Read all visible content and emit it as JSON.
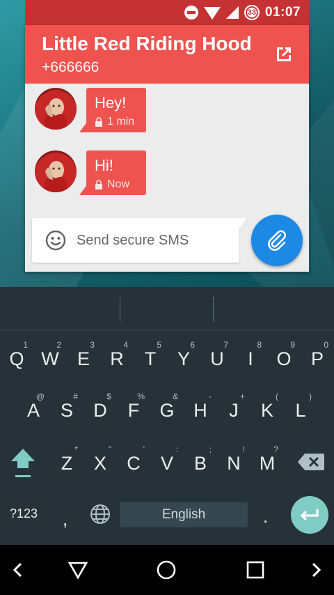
{
  "status_bar": {
    "notification_count": "33",
    "time": "01:07",
    "icons": [
      "do-not-disturb-icon",
      "wifi-icon",
      "cell-signal-icon",
      "notification-badge-icon"
    ]
  },
  "conversation": {
    "contact_name": "Little Red Riding Hood",
    "phone_number": "+666666",
    "open_icon": "open-in-new-icon",
    "messages": [
      {
        "text": "Hey!",
        "time": "1 min",
        "secure": true
      },
      {
        "text": "Hi!",
        "time": "Now",
        "secure": true
      }
    ]
  },
  "composer": {
    "placeholder": "Send secure SMS",
    "emoji_icon": "emoji-icon",
    "attach_icon": "paperclip-icon"
  },
  "colors": {
    "header": "#ef5350",
    "status_bar": "#c53234",
    "attach_button": "#1e88e5",
    "keyboard": "#263238",
    "enter_key": "#80cbc4"
  },
  "keyboard": {
    "rows": [
      {
        "keys": [
          [
            "Q",
            "1"
          ],
          [
            "W",
            "2"
          ],
          [
            "E",
            "3"
          ],
          [
            "R",
            "4"
          ],
          [
            "T",
            "5"
          ],
          [
            "Y",
            "6"
          ],
          [
            "U",
            "7"
          ],
          [
            "I",
            "8"
          ],
          [
            "O",
            "9"
          ],
          [
            "P",
            "0"
          ]
        ]
      },
      {
        "keys": [
          [
            "A",
            "@"
          ],
          [
            "S",
            "#"
          ],
          [
            "D",
            "$"
          ],
          [
            "F",
            "%"
          ],
          [
            "G",
            "&"
          ],
          [
            "H",
            "-"
          ],
          [
            "J",
            "+"
          ],
          [
            "K",
            "("
          ],
          [
            "L",
            ")"
          ]
        ]
      },
      {
        "keys": [
          [
            "Z",
            "*"
          ],
          [
            "X",
            "\""
          ],
          [
            "C",
            "'"
          ],
          [
            "V",
            ":"
          ],
          [
            "B",
            ";"
          ],
          [
            "N",
            "!"
          ],
          [
            "M",
            "?"
          ]
        ]
      }
    ],
    "symbols_label": "?123",
    "comma": ",",
    "space_label": "English",
    "period": "."
  },
  "nav_bar": {
    "items": [
      "back-icon",
      "home-triangle-icon",
      "home-circle-icon",
      "recents-icon",
      "forward-icon"
    ]
  }
}
